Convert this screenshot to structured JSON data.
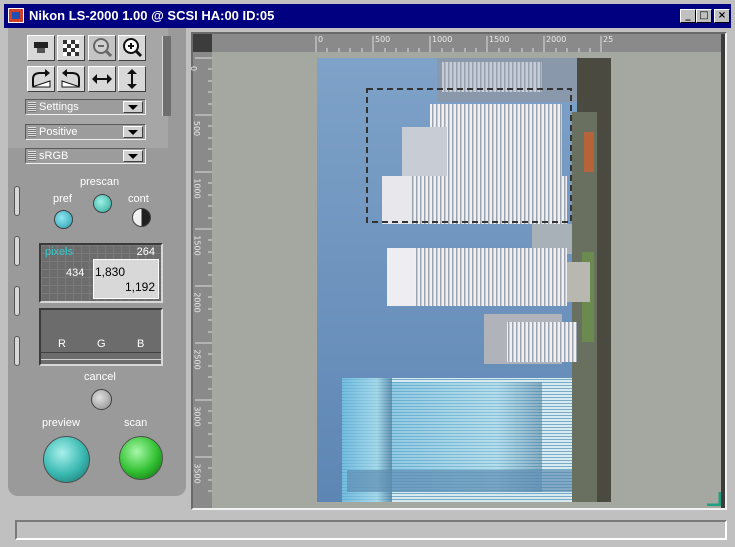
{
  "window": {
    "title": "Nikon LS-2000 1.00 @ SCSI HA:00 ID:05"
  },
  "titlebar_buttons": [
    {
      "name": "minimize",
      "glyph": "_"
    },
    {
      "name": "maximize",
      "glyph": "□"
    },
    {
      "name": "close",
      "glyph": "×"
    }
  ],
  "toolbar": {
    "row1": [
      "scanner-icon",
      "crop-pattern-icon",
      "zoom-out-icon",
      "zoom-in-icon"
    ],
    "row2": [
      "rotate-right-icon",
      "rotate-left-icon",
      "flip-horizontal-icon",
      "flip-vertical-icon"
    ]
  },
  "dropdowns": {
    "settings": "Settings",
    "film_type": "Positive",
    "color_space": "sRGB"
  },
  "scan_modes": {
    "prescan_label": "prescan",
    "pref_label": "pref",
    "cont_label": "cont"
  },
  "crop_info": {
    "unit": "pixels",
    "top": "264",
    "left": "434",
    "width": "1,830",
    "height": "1,192"
  },
  "histogram": {
    "channels": [
      "R",
      "G",
      "B"
    ]
  },
  "actions": {
    "cancel_label": "cancel",
    "preview_label": "preview",
    "scan_label": "scan"
  },
  "ruler": {
    "horizontal_labels": [
      "0",
      "500",
      "1000",
      "1500",
      "2000",
      "25"
    ],
    "vertical_labels": [
      "0",
      "500",
      "1000",
      "1500",
      "2000",
      "2500",
      "3000",
      "3500"
    ]
  },
  "status_bar": {
    "text": ""
  },
  "colors": {
    "titlebar": "#000080",
    "accent_cyan": "#38c8c8",
    "scan_green": "#30c030",
    "preview_teal": "#38b8b0"
  }
}
